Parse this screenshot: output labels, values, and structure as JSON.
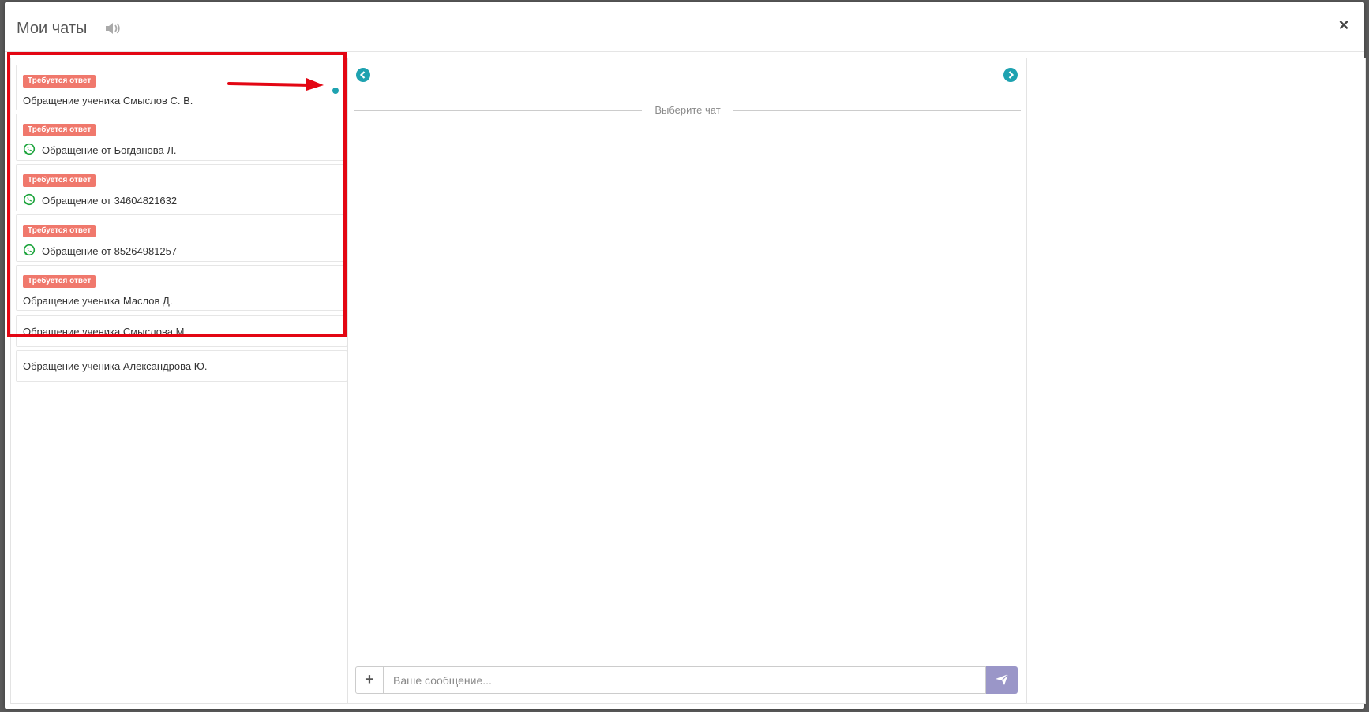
{
  "modal": {
    "title": "Мои чаты",
    "icons": {
      "sound": "volume-icon",
      "close": "close-icon"
    },
    "close_label": "×"
  },
  "chat_list": [
    {
      "badge": "Требуется ответ",
      "title": "Обращение ученика Смыслов С. В.",
      "channel": "internal",
      "unread": true
    },
    {
      "badge": "Требуется ответ",
      "title": "Обращение от Богданова Л.",
      "channel": "whatsapp",
      "unread": false
    },
    {
      "badge": "Требуется ответ",
      "title": "Обращение от 34604821632",
      "channel": "whatsapp",
      "unread": false
    },
    {
      "badge": "Требуется ответ",
      "title": "Обращение от 85264981257",
      "channel": "whatsapp",
      "unread": false
    },
    {
      "badge": "Требуется ответ",
      "title": "Обращение ученика Маслов Д.",
      "channel": "internal",
      "unread": false
    },
    {
      "badge": "",
      "title": "Обращение ученика Смыслова М.",
      "channel": "internal",
      "unread": false
    },
    {
      "badge": "",
      "title": "Обращение ученика Александрова Ю.",
      "channel": "internal",
      "unread": false
    }
  ],
  "chat_panel": {
    "placeholder_text": "Выберите чат",
    "nav_icons": {
      "left": "chevron-left-circle-icon",
      "right": "chevron-right-circle-icon"
    }
  },
  "composer": {
    "attach_label": "+",
    "message_placeholder": "Ваше сообщение...",
    "send_icon": "paper-plane-icon"
  },
  "colors": {
    "badge": "#f0786c",
    "accent": "#1ea2b0",
    "whatsapp": "#1aa33a",
    "send_button": "#9a96c8",
    "annotation": "#e30613"
  }
}
